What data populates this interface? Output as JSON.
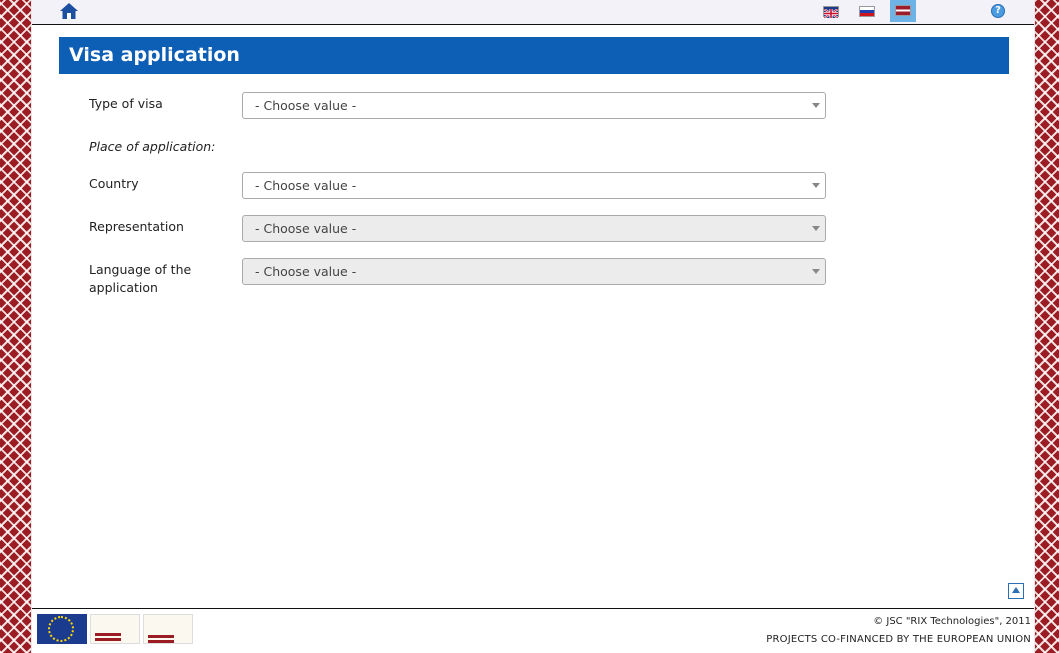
{
  "topbar": {
    "home_icon": "home-icon",
    "languages": [
      {
        "code": "en",
        "icon": "flag-uk-icon",
        "active": false
      },
      {
        "code": "ru",
        "icon": "flag-ru-icon",
        "active": false
      },
      {
        "code": "lv",
        "icon": "flag-lv-icon",
        "active": true
      }
    ],
    "help_icon": "help-icon",
    "help_glyph": "?"
  },
  "page_title": "Visa application",
  "form": {
    "type_of_visa": {
      "label": "Type of visa",
      "value": "- Choose value -",
      "disabled": false
    },
    "place_heading": "Place of application:",
    "country": {
      "label": "Country",
      "value": "- Choose value -",
      "disabled": false
    },
    "representation": {
      "label": "Representation",
      "value": "- Choose value -",
      "disabled": true
    },
    "language": {
      "label_line1": "Language of the",
      "label_line2": "application",
      "value": "- Choose value -",
      "disabled": true
    }
  },
  "footer": {
    "copyright": "© JSC \"RIX Technologies\", 2011",
    "cofinanced": "PROJECTS CO-FINANCED BY THE EUROPEAN UNION",
    "logos": [
      "eu-flag-logo",
      "solidarity-fund-logo",
      "external-borders-fund-logo"
    ]
  },
  "colors": {
    "title_bar": "#0d5eb5",
    "ornament": "#9b1c22",
    "active_language": "#6fb2e6"
  }
}
